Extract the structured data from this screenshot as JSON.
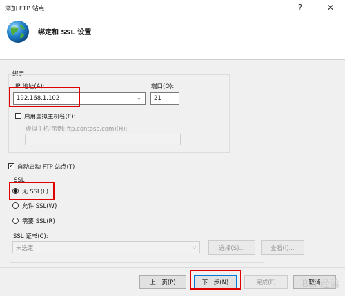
{
  "window": {
    "title": "添加 FTP 站点",
    "help_glyph": "?",
    "close_glyph": "✕"
  },
  "header": {
    "title": "绑定和 SSL 设置"
  },
  "binding": {
    "group_label": "绑定",
    "ip_label": "IP 地址(A):",
    "ip_value": "192.168.1.102",
    "port_label": "端口(O):",
    "port_value": "21",
    "virtual_host_checkbox_label": "启用虚拟主机名(E):",
    "virtual_host_label": "虚拟主机(示例: ftp.contoso.com)(H):",
    "virtual_host_value": ""
  },
  "autostart": {
    "label": "自动启动 FTP 站点(T)",
    "checked": true
  },
  "ssl": {
    "group_label": "SSL",
    "options": [
      {
        "label": "无 SSL(L)",
        "selected": true
      },
      {
        "label": "允许 SSL(W)",
        "selected": false
      },
      {
        "label": "需要 SSL(R)",
        "selected": false
      }
    ],
    "cert_label": "SSL 证书(C):",
    "cert_value": "未选定",
    "select_button": "选择(S)...",
    "view_button": "查看(I)..."
  },
  "footer": {
    "prev_button": "上一页(P)",
    "next_button": "下一步(N)",
    "finish_button": "完成(F)",
    "cancel_button": "取消"
  },
  "watermark": {
    "text": "Bai 经验"
  },
  "colors": {
    "highlight_red": "#e00000",
    "accent": "#0078d7"
  }
}
